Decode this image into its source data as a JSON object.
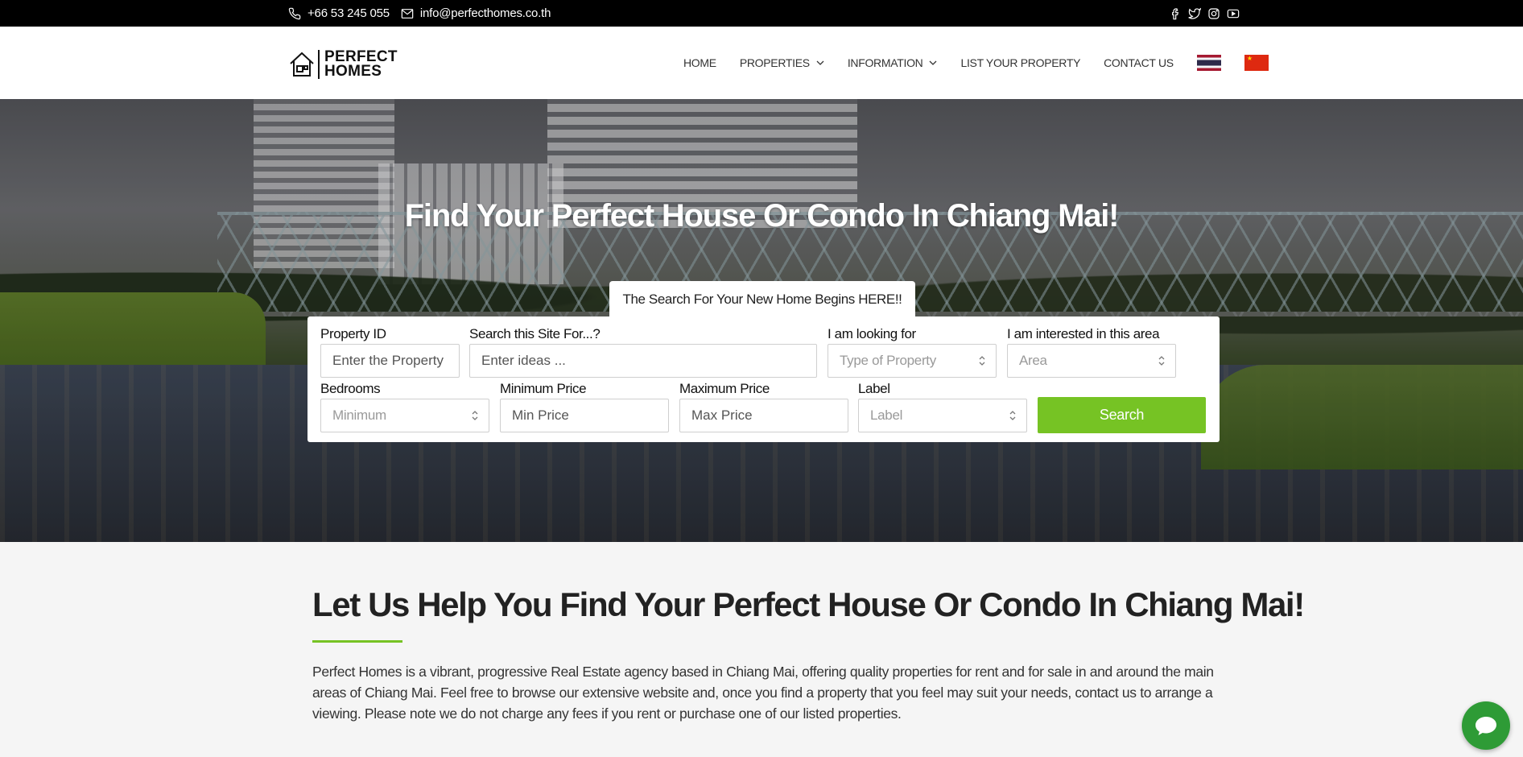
{
  "topbar": {
    "phone": "+66 53 245 055",
    "email": "info@perfecthomes.co.th",
    "social": [
      "facebook-icon",
      "twitter-icon",
      "instagram-icon",
      "youtube-icon"
    ]
  },
  "header": {
    "logo_line1": "PERFECT",
    "logo_line2": "HOMES",
    "nav": {
      "home": "HOME",
      "properties": "PROPERTIES",
      "information": "INFORMATION",
      "list_property": "LIST YOUR PROPERTY",
      "contact": "CONTACT US"
    },
    "languages": [
      "thai-flag-icon",
      "china-flag-icon"
    ]
  },
  "hero": {
    "title": "Find Your Perfect House Or Condo In Chiang Mai!",
    "search_tab": "The Search For Your New Home Begins HERE!!"
  },
  "search": {
    "property_id": {
      "label": "Property ID",
      "placeholder": "Enter the Property ID"
    },
    "site_search": {
      "label": "Search this Site For...?",
      "placeholder": "Enter ideas ..."
    },
    "looking_for": {
      "label": "I am looking for",
      "value": "Type of Property"
    },
    "area": {
      "label": "I am interested in this area",
      "value": "Area"
    },
    "bedrooms": {
      "label": "Bedrooms",
      "value": "Minimum"
    },
    "min_price": {
      "label": "Minimum Price",
      "placeholder": "Min Price"
    },
    "max_price": {
      "label": "Maximum Price",
      "placeholder": "Max Price"
    },
    "label": {
      "label": "Label",
      "value": "Label"
    },
    "button": "Search"
  },
  "intro": {
    "title": "Let Us Help You Find Your Perfect House Or Condo In Chiang Mai!",
    "text": "Perfect Homes is a vibrant, progressive Real Estate agency based in Chiang Mai, offering quality properties for rent and for sale in and around the main areas of Chiang Mai. Feel free to browse our extensive website and, once you find a property that you feel may suit your needs, contact us to arrange a viewing. Please note we do not charge any fees if you rent or purchase one of our listed properties."
  },
  "colors": {
    "accent": "#76c324",
    "chat": "#2e9b36",
    "topbar": "#000000"
  }
}
